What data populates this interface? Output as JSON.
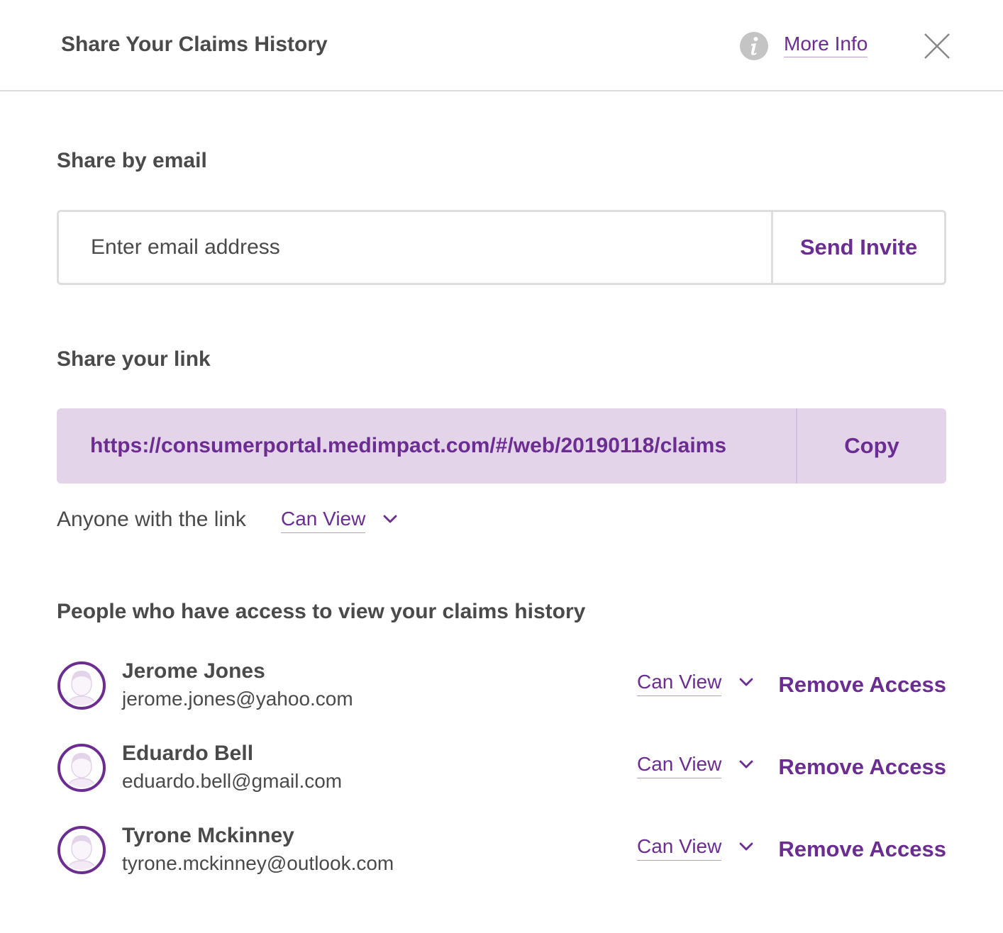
{
  "header": {
    "title": "Share Your Claims History",
    "more_info_label": "More Info"
  },
  "email_section": {
    "label": "Share by email",
    "placeholder": "Enter email address",
    "send_label": "Send Invite"
  },
  "link_section": {
    "label": "Share your link",
    "url": "https://consumerportal.medimpact.com/#/web/20190118/claims",
    "copy_label": "Copy",
    "anyone_label": "Anyone with the link",
    "permission": "Can View"
  },
  "people_section": {
    "label": "People who have access to view your claims history",
    "people": [
      {
        "name": "Jerome Jones",
        "email": "jerome.jones@yahoo.com",
        "permission": "Can View",
        "remove_label": "Remove Access"
      },
      {
        "name": "Eduardo Bell",
        "email": "eduardo.bell@gmail.com",
        "permission": "Can View",
        "remove_label": "Remove Access"
      },
      {
        "name": "Tyrone Mckinney",
        "email": "tyrone.mckinney@outlook.com",
        "permission": "Can View",
        "remove_label": "Remove Access"
      }
    ]
  },
  "colors": {
    "accent": "#6b2d91",
    "link_background": "#e4d4ea",
    "text": "#4a4a4a",
    "divider": "#dcdcdc"
  },
  "icons": {
    "info": "info-icon",
    "close": "close-icon",
    "chevron": "chevron-down-icon",
    "avatar": "avatar-icon"
  }
}
